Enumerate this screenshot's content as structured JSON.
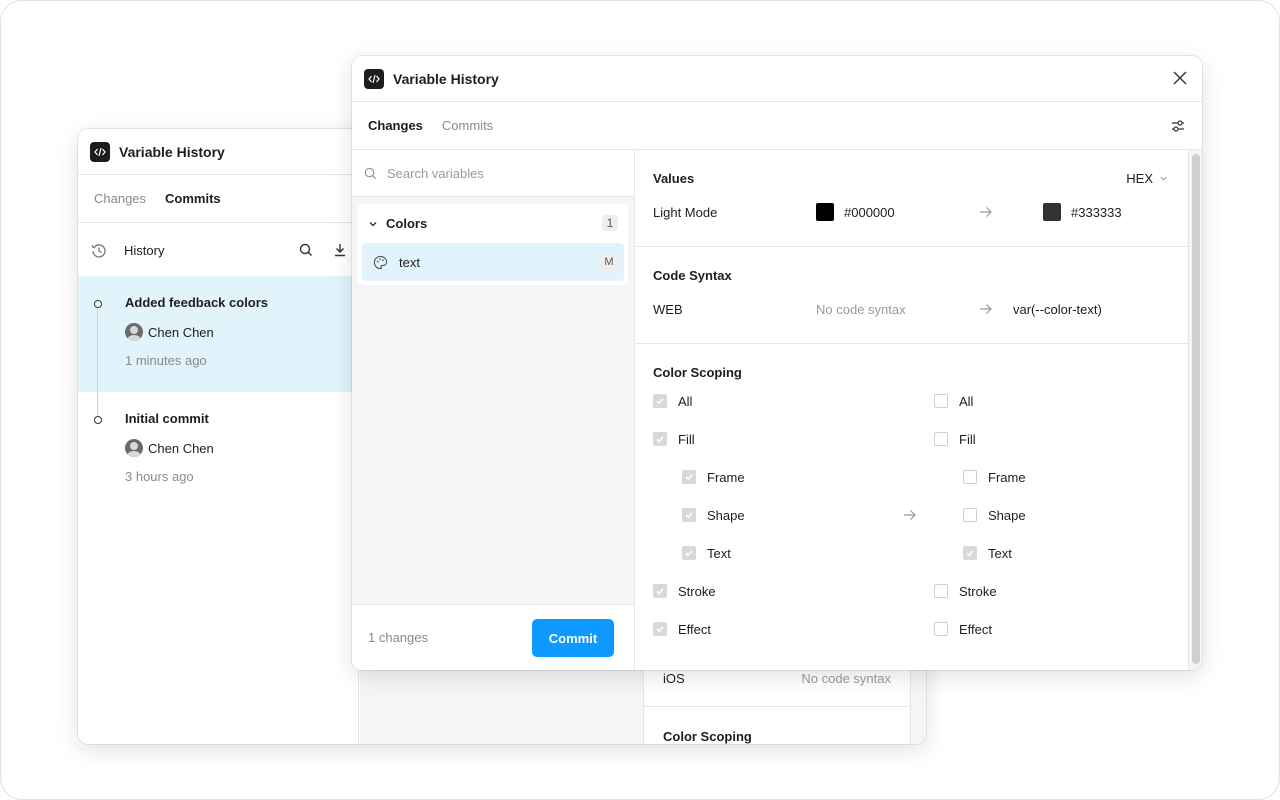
{
  "app": {
    "title": "Variable History"
  },
  "back": {
    "title": "Variable History",
    "tabs": [
      "Changes",
      "Commits"
    ],
    "history_label": "History",
    "commits": [
      {
        "title": "Added feedback colors",
        "author": "Chen Chen",
        "time": "1 minutes ago"
      },
      {
        "title": "Initial commit",
        "author": "Chen Chen",
        "time": "3 hours ago"
      }
    ],
    "ios_label": "iOS",
    "ios_value": "No code syntax",
    "color_scoping": "Color Scoping"
  },
  "front": {
    "title": "Variable History",
    "tabs": [
      "Changes",
      "Commits"
    ],
    "search": {
      "placeholder": "Search variables"
    },
    "group": {
      "name": "Colors",
      "count": "1"
    },
    "variable": {
      "name": "text",
      "badge": "M"
    },
    "footer": {
      "changes": "1 changes",
      "commit_label": "Commit"
    },
    "values": {
      "title": "Values",
      "format": "HEX",
      "mode": "Light Mode",
      "old": "#000000",
      "new": "#333333",
      "old_color": "#000000",
      "new_color": "#333333"
    },
    "code_syntax": {
      "title": "Code Syntax",
      "platform": "WEB",
      "old": "No code syntax",
      "new": "var(--color-text)"
    },
    "scoping": {
      "title": "Color Scoping",
      "rows": [
        {
          "label": "All",
          "indent": false,
          "old": true,
          "new": false
        },
        {
          "label": "Fill",
          "indent": false,
          "old": true,
          "new": false
        },
        {
          "label": "Frame",
          "indent": true,
          "old": true,
          "new": false
        },
        {
          "label": "Shape",
          "indent": true,
          "old": true,
          "new": false
        },
        {
          "label": "Text",
          "indent": true,
          "old": true,
          "new": true
        },
        {
          "label": "Stroke",
          "indent": false,
          "old": true,
          "new": false
        },
        {
          "label": "Effect",
          "indent": false,
          "old": true,
          "new": false
        }
      ]
    }
  },
  "colors": {
    "accent": "#0d99ff",
    "selection": "#e1f4fc"
  }
}
